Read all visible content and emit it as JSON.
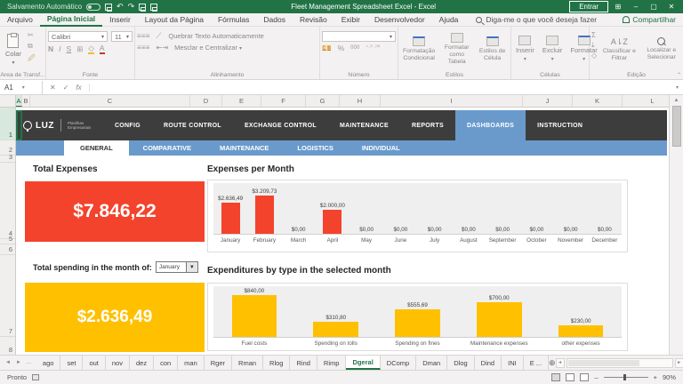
{
  "titlebar": {
    "autosave_label": "Salvamento Automático",
    "title": "Fleet Management Spreadsheet Excel - Excel",
    "signin_label": "Entrar"
  },
  "icons": {
    "undo": "↶",
    "redo": "↷",
    "dropdown": "▾",
    "chevron_small": "⌄",
    "minimize": "–",
    "maximize": "▢",
    "close": "✕",
    "ribbon_display": "⊞",
    "scissors": "✂",
    "copy": "⧉",
    "borders": "⊞",
    "sum": "Σ",
    "left_arrow": "◄",
    "right_arrow": "►",
    "up_arrow": "▲",
    "overflow": "...",
    "check": "✓",
    "x": "✕",
    "fx": "fx",
    "add": "⊕",
    "collapse": "⌃",
    "align_lines": "≡ ≡ ≡",
    "percent": "%",
    "thousands": "000",
    "minus": "–",
    "plus": "+"
  },
  "menubar": {
    "tabs": [
      {
        "label": "Arquivo",
        "active": false
      },
      {
        "label": "Página Inicial",
        "active": true
      },
      {
        "label": "Inserir",
        "active": false
      },
      {
        "label": "Layout da Página",
        "active": false
      },
      {
        "label": "Fórmulas",
        "active": false
      },
      {
        "label": "Dados",
        "active": false
      },
      {
        "label": "Revisão",
        "active": false
      },
      {
        "label": "Exibir",
        "active": false
      },
      {
        "label": "Desenvolvedor",
        "active": false
      },
      {
        "label": "Ajuda",
        "active": false
      }
    ],
    "tellme_label": "Diga-me o que você deseja fazer",
    "share_label": "Compartilhar"
  },
  "ribbon": {
    "paste_label": "Colar",
    "font_name": "Calibri",
    "font_size": "11",
    "bold_label": "N",
    "italic_label": "I",
    "underline_label": "S",
    "wrap_label": "Quebrar Texto Automaticamente",
    "merge_label": "Mesclar e Centralizar",
    "cond_format_label": "Formatação Condicional",
    "format_table_label": "Formatar como Tabela",
    "cell_styles_label": "Estilos de Célula",
    "insert_label": "Inserir",
    "delete_label": "Excluir",
    "format_label": "Formatar",
    "sort_filter_label": "Classificar e Filtrar",
    "find_select_label": "Localizar e Selecionar",
    "groups": {
      "clipboard": "Área de Transf...",
      "font": "Fonte",
      "alignment": "Alinhamento",
      "number": "Número",
      "styles": "Estilos",
      "cells": "Células",
      "editing": "Edição"
    }
  },
  "formula_bar": {
    "name_box": "A1"
  },
  "grid": {
    "columns": [
      "A",
      "B",
      "C",
      "D",
      "E",
      "F",
      "G",
      "H",
      "I",
      "J",
      "K",
      "L"
    ],
    "rows": [
      "1",
      "2",
      "3",
      "4",
      "5",
      "6",
      "7",
      "8"
    ]
  },
  "workbook_nav": {
    "brand": "LUZ",
    "brand_sub": "Planilhas Empresariais",
    "items": [
      {
        "label": "CONFIG",
        "active": false
      },
      {
        "label": "ROUTE CONTROL",
        "active": false
      },
      {
        "label": "EXCHANGE CONTROL",
        "active": false
      },
      {
        "label": "MAINTENANCE",
        "active": false
      },
      {
        "label": "REPORTS",
        "active": false
      },
      {
        "label": "DASHBOARDS",
        "active": true
      },
      {
        "label": "INSTRUCTION",
        "active": false
      }
    ]
  },
  "subtabs": {
    "items": [
      {
        "label": "GENERAL",
        "active": true
      },
      {
        "label": "COMPARATIVE",
        "active": false
      },
      {
        "label": "MAINTENANCE",
        "active": false
      },
      {
        "label": "LOGISTICS",
        "active": false
      },
      {
        "label": "INDIVIDUAL",
        "active": false
      }
    ]
  },
  "dashboard": {
    "total_expenses_title": "Total Expenses",
    "total_expenses_value": "$7.846,22",
    "month_chart_title": "Expenses per Month",
    "month_select_label": "Total spending in the month of:",
    "month_select_value": "January",
    "month_total_value": "$2.636,49",
    "type_chart_title": "Expenditures by type in the selected month"
  },
  "chart_data": [
    {
      "type": "bar",
      "title": "Expenses per Month",
      "categories": [
        "January",
        "February",
        "March",
        "April",
        "May",
        "June",
        "July",
        "August",
        "September",
        "October",
        "November",
        "December"
      ],
      "values": [
        2636.49,
        3209.73,
        0,
        2000.0,
        0,
        0,
        0,
        0,
        0,
        0,
        0,
        0
      ],
      "labels": [
        "$2.636,49",
        "$3.209,73",
        "$0,00",
        "$2.000,00",
        "$0,00",
        "$0,00",
        "$0,00",
        "$0,00",
        "$0,00",
        "$0,00",
        "$0,00",
        "$0,00"
      ],
      "bar_color": "#f4432c",
      "xlabel": "",
      "ylabel": "",
      "ylim": [
        0,
        3209.73
      ],
      "grid": false,
      "legend": "none"
    },
    {
      "type": "bar",
      "title": "Expenditures by type in the selected month",
      "categories": [
        "Fuel costs",
        "Spending on tolls",
        "Spending on fines",
        "Maintenance expenses",
        "other expenses"
      ],
      "values": [
        840.0,
        310.8,
        555.69,
        700.0,
        230.0
      ],
      "labels": [
        "$840,00",
        "$310,80",
        "$555,69",
        "$700,00",
        "$230,00"
      ],
      "bar_color": "#ffc000",
      "xlabel": "",
      "ylabel": "",
      "ylim": [
        0,
        840
      ],
      "grid": false,
      "legend": "none"
    }
  ],
  "sheet_tabs": {
    "tabs": [
      {
        "label": "ago",
        "active": false
      },
      {
        "label": "set",
        "active": false
      },
      {
        "label": "out",
        "active": false
      },
      {
        "label": "nov",
        "active": false
      },
      {
        "label": "dez",
        "active": false
      },
      {
        "label": "con",
        "active": false
      },
      {
        "label": "man",
        "active": false
      },
      {
        "label": "Rger",
        "active": false
      },
      {
        "label": "Rman",
        "active": false
      },
      {
        "label": "Rlog",
        "active": false
      },
      {
        "label": "Rind",
        "active": false
      },
      {
        "label": "Rimp",
        "active": false
      },
      {
        "label": "Dgeral",
        "active": true
      },
      {
        "label": "DComp",
        "active": false
      },
      {
        "label": "Dman",
        "active": false
      },
      {
        "label": "Dlog",
        "active": false
      },
      {
        "label": "Dind",
        "active": false
      },
      {
        "label": "INI",
        "active": false
      },
      {
        "label": "E ...",
        "active": false
      }
    ]
  },
  "statusbar": {
    "ready_label": "Pronto",
    "zoom_level": "90%"
  }
}
